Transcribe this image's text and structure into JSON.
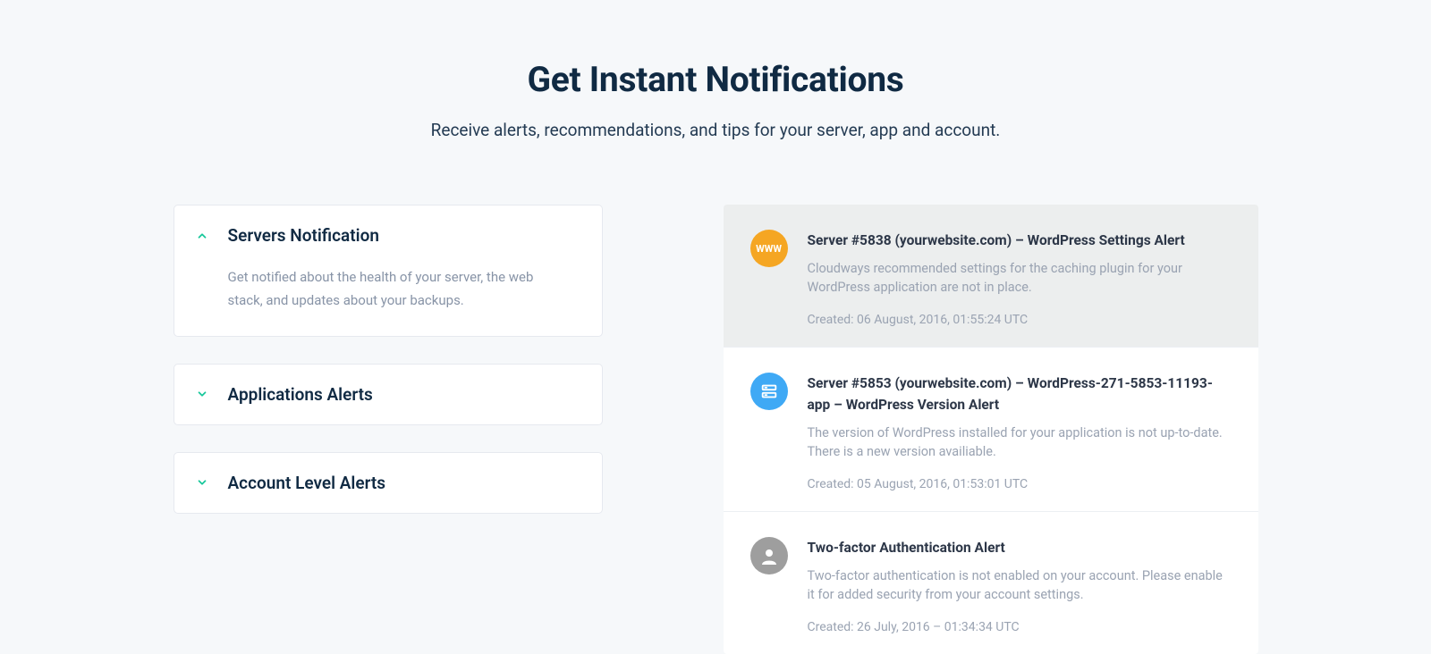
{
  "hero": {
    "title": "Get Instant Notifications",
    "subtitle": "Receive alerts, recommendations, and tips for your server, app and account."
  },
  "accordion": [
    {
      "name": "servers-notification",
      "title": "Servers Notification",
      "body": "Get notified about the health of your server, the web stack, and updates about your backups.",
      "expanded": true
    },
    {
      "name": "applications-alerts",
      "title": "Applications Alerts",
      "expanded": false
    },
    {
      "name": "account-level-alerts",
      "title": "Account Level Alerts",
      "expanded": false
    }
  ],
  "notifications": [
    {
      "icon": "www",
      "icon_label": "WWW",
      "selected": true,
      "title": "Server #5838 (yourwebsite.com) – WordPress Settings Alert",
      "desc": "Cloudways recommended settings for the caching plugin for your WordPress application are not in place.",
      "created_label": "Created: 06 August, 2016, 01:55:24 UTC"
    },
    {
      "icon": "server",
      "selected": false,
      "title": "Server #5853 (yourwebsite.com) – WordPress-271-5853-11193-app – WordPress Version Alert",
      "desc": "The version of WordPress installed for your application is not up-to-date. There is a new version availiable.",
      "created_label": "Created: 05 August, 2016, 01:53:01 UTC"
    },
    {
      "icon": "user",
      "selected": false,
      "title": "Two-factor Authentication Alert",
      "desc": "Two-factor authentication is not enabled on your account. Please enable it for added security from your account settings.",
      "created_label": "Created: 26 July, 2016 – 01:34:34 UTC"
    }
  ]
}
